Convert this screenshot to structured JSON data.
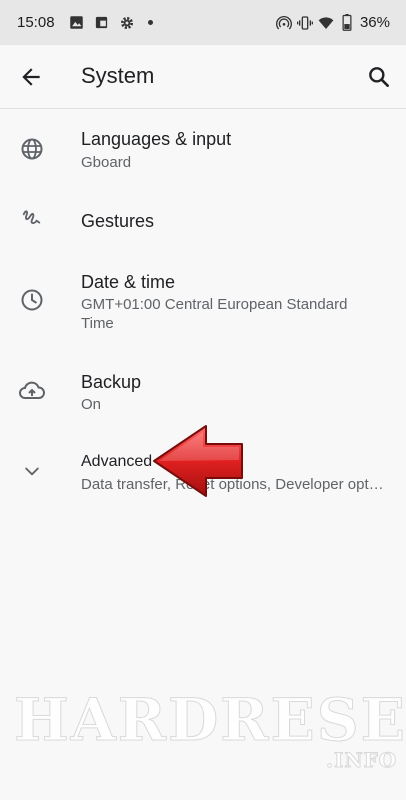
{
  "status_bar": {
    "time": "15:08",
    "battery": "36%",
    "icons": [
      "image-icon",
      "clipboard-icon",
      "settings-gear-icon",
      "dot-icon",
      "hotspot-icon",
      "vibrate-icon",
      "wifi-icon",
      "battery-icon"
    ]
  },
  "app_bar": {
    "title": "System",
    "back_icon": "arrow-back-icon",
    "search_icon": "search-icon"
  },
  "items": [
    {
      "title": "Languages & input",
      "summary": "Gboard",
      "icon": "globe-icon"
    },
    {
      "title": "Gestures",
      "summary": "",
      "icon": "gesture-icon"
    },
    {
      "title": "Date & time",
      "summary": "GMT+01:00 Central European Standard Time",
      "icon": "clock-icon"
    },
    {
      "title": "Backup",
      "summary": "On",
      "icon": "cloud-upload-icon"
    },
    {
      "title": "Advanced",
      "summary": "Data transfer, Reset options, Developer opt…",
      "icon": "chevron-down-icon"
    }
  ],
  "overlay": {
    "arrow_color": "#d81e1e",
    "watermark": "HARDRESET",
    "watermark_sub": ".INFO"
  }
}
